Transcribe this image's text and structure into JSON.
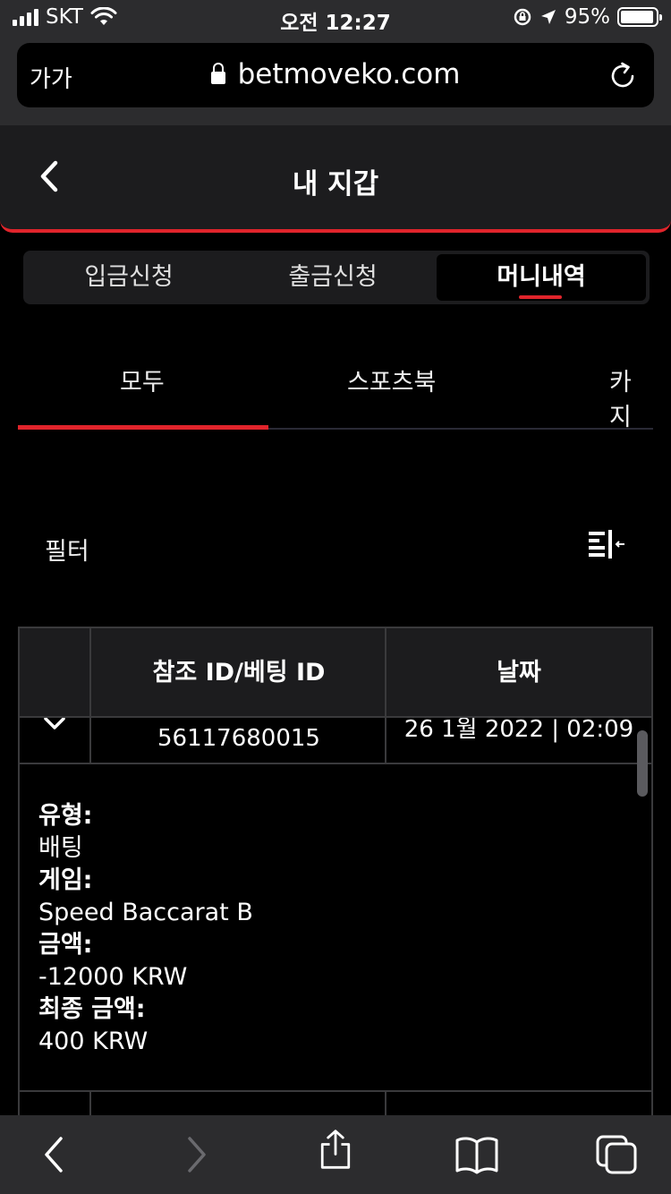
{
  "status_bar": {
    "carrier": "SKT",
    "time": "오전 12:27",
    "battery": "95%",
    "battery_level": 0.95,
    "icons": [
      "signal-icon",
      "wifi-icon",
      "rotation-lock-icon",
      "location-icon",
      "battery-icon"
    ]
  },
  "browser": {
    "text_size": "가가",
    "url": "betmoveko.com"
  },
  "header": {
    "title": "내 지갑"
  },
  "segments": [
    {
      "label": "입금신청",
      "active": false
    },
    {
      "label": "출금신청",
      "active": false
    },
    {
      "label": "머니내역",
      "active": true
    }
  ],
  "subtabs": [
    {
      "label": "모두",
      "active": true
    },
    {
      "label": "스포츠북",
      "active": false
    },
    {
      "label": "카지",
      "active": false
    }
  ],
  "filter": {
    "label": "필터"
  },
  "table": {
    "columns": [
      "",
      "참조 ID/베팅 ID",
      "날짜"
    ],
    "row": {
      "ref_id": "56117680015",
      "date": "26 1월 2022 | 02:09"
    },
    "details": {
      "type_label": "유형:",
      "type_value": "배팅",
      "game_label": "게임:",
      "game_value": "Speed Baccarat B",
      "amount_label": "금액:",
      "amount_value": "-12000 KRW",
      "final_label": "최종 금액:",
      "final_value": "400 KRW"
    }
  },
  "colors": {
    "accent": "#e0242b",
    "background": "#000000",
    "surface": "#1c1c1e",
    "chrome": "#2c2c2e"
  }
}
